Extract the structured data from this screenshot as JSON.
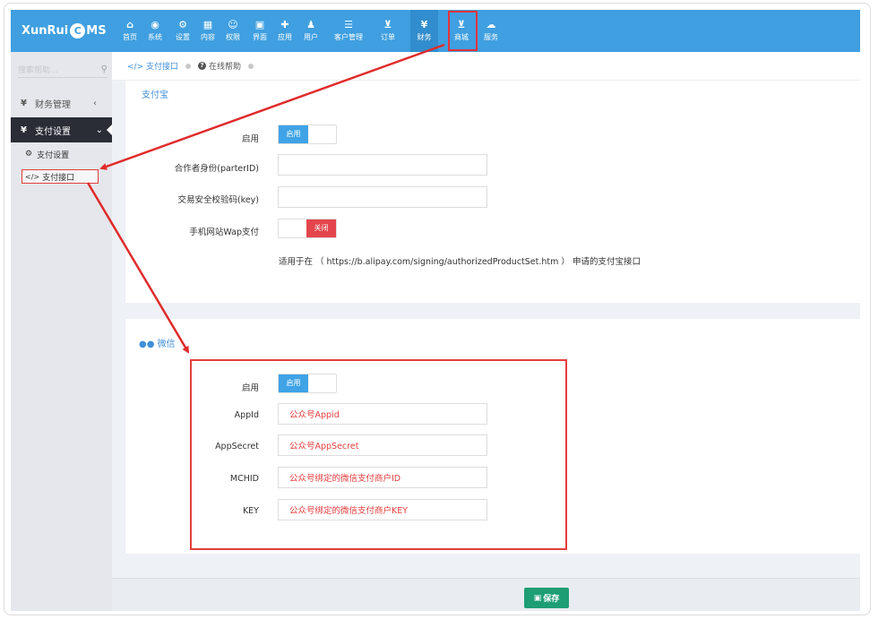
{
  "brand": {
    "logo_text_left": "XunRui",
    "logo_letter": "C",
    "logo_text_right": "MS"
  },
  "nav": [
    {
      "label": "首页",
      "icon": "home-icon",
      "glyph": "⌂"
    },
    {
      "label": "系统",
      "icon": "globe-icon",
      "glyph": "◉"
    },
    {
      "label": "设置",
      "icon": "gears-icon",
      "glyph": "⚙"
    },
    {
      "label": "内容",
      "icon": "grid-icon",
      "glyph": "▦"
    },
    {
      "label": "权限",
      "icon": "user-circle-icon",
      "glyph": "☺"
    },
    {
      "label": "界面",
      "icon": "window-icon",
      "glyph": "▣"
    },
    {
      "label": "应用",
      "icon": "puzzle-icon",
      "glyph": "✚"
    },
    {
      "label": "用户",
      "icon": "user-icon",
      "glyph": "♟"
    },
    {
      "label": "客户管理",
      "icon": "list-icon",
      "glyph": "☰"
    },
    {
      "label": "订单",
      "icon": "cart-icon",
      "glyph": "⊻"
    },
    {
      "label": "财务",
      "icon": "yen-icon",
      "glyph": "¥"
    },
    {
      "label": "商城",
      "icon": "cart-icon",
      "glyph": "⊻"
    },
    {
      "label": "服务",
      "icon": "cloud-icon",
      "glyph": "☁"
    }
  ],
  "sidebar": {
    "search_placeholder": "搜索帮助...",
    "finance_label": "财务管理",
    "payset_label": "支付设置",
    "sub_payset_label": "支付设置",
    "sub_payapi_label": "支付接口"
  },
  "breadcrumb": {
    "current": "支付接口",
    "help": "在线帮助"
  },
  "alipay": {
    "title": "支付宝",
    "enable_label": "启用",
    "enable_on": "启用",
    "partner_label": "合作者身份(parterID)",
    "partner_value": "",
    "key_label": "交易安全校验码(key)",
    "key_value": "",
    "wap_label": "手机网站Wap支付",
    "wap_off": "关闭",
    "help": "适用于在 （ https://b.alipay.com/signing/authorizedProductSet.htm ） 申请的支付宝接口"
  },
  "wechat": {
    "title": "微信",
    "enable_label": "启用",
    "enable_on": "启用",
    "appid_label": "AppId",
    "appid_value": "公众号Appid",
    "secret_label": "AppSecret",
    "secret_value": "公众号AppSecret",
    "mchid_label": "MCHID",
    "mchid_value": "公众号绑定的微信支付商户ID",
    "key_label": "KEY",
    "key_value": "公众号绑定的微信支付商户KEY"
  },
  "footer": {
    "save_label": "保存"
  },
  "colors": {
    "topbar": "#3f9fe0",
    "accent": "#3f8fd8",
    "danger": "#e53d3d",
    "save": "#1e9e75",
    "sidebar_active": "#2a2d36"
  }
}
